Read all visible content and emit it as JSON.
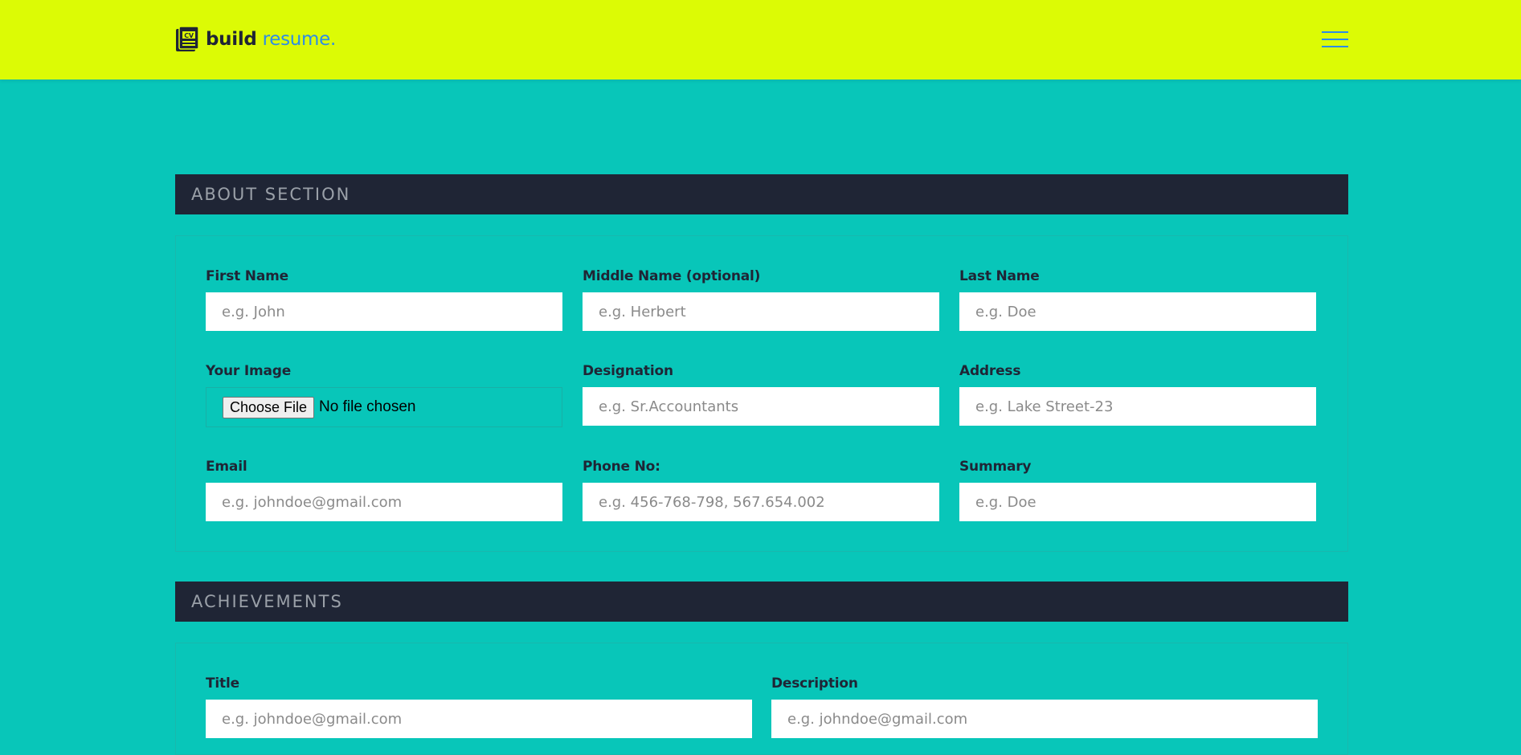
{
  "brand": {
    "word1": "build",
    "word2": "resume.",
    "icon": "cv-document-icon",
    "icon_text": "CV"
  },
  "nav": {
    "menu_icon": "hamburger-menu-icon"
  },
  "colors": {
    "page_bg": "#08c6b9",
    "navbar_bg": "#dcfb05",
    "section_header_bg": "#1f2535",
    "accent_blue": "#2d8ce6"
  },
  "about": {
    "heading": "ABOUT SECTION",
    "fields": {
      "first_name": {
        "label": "First Name",
        "placeholder": "e.g. John"
      },
      "middle_name": {
        "label": "Middle Name (optional)",
        "placeholder": "e.g. Herbert"
      },
      "last_name": {
        "label": "Last Name",
        "placeholder": "e.g. Doe"
      },
      "image": {
        "label": "Your Image",
        "button": "Choose File",
        "status": "No file chosen"
      },
      "designation": {
        "label": "Designation",
        "placeholder": "e.g. Sr.Accountants"
      },
      "address": {
        "label": "Address",
        "placeholder": "e.g. Lake Street-23"
      },
      "email": {
        "label": "Email",
        "placeholder": "e.g. johndoe@gmail.com"
      },
      "phone": {
        "label": "Phone No:",
        "placeholder": "e.g. 456-768-798, 567.654.002"
      },
      "summary": {
        "label": "Summary",
        "placeholder": "e.g. Doe"
      }
    }
  },
  "achievements": {
    "heading": "ACHIEVEMENTS",
    "fields": {
      "title": {
        "label": "Title",
        "placeholder": "e.g. johndoe@gmail.com"
      },
      "description": {
        "label": "Description",
        "placeholder": "e.g. johndoe@gmail.com"
      }
    }
  }
}
